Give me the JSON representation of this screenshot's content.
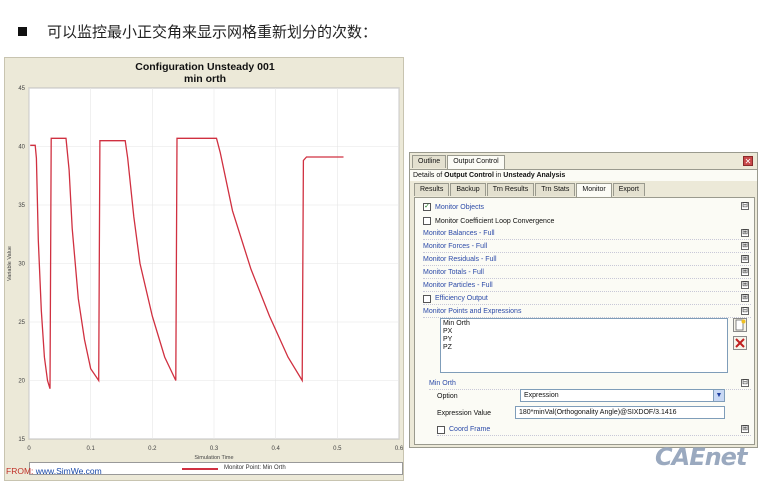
{
  "heading": "可以监控最小正交角来显示网格重新划分的次数：",
  "chart": {
    "title_line1": "Configuration Unsteady 001",
    "title_line2": "min orth",
    "legend_label": "Monitor Point: Min Orth",
    "line_color": "#d03040"
  },
  "chart_data": {
    "type": "line",
    "title": "Configuration Unsteady 001\nmin orth",
    "xlabel": "Simulation Time",
    "ylabel": "Variable Value",
    "xlim": [
      0,
      0.6
    ],
    "ylim": [
      15,
      45
    ],
    "x_ticks": [
      "0",
      "0.1",
      "0.2",
      "0.3",
      "0.4",
      "0.5",
      "0.6"
    ],
    "y_ticks": [
      "15",
      "20",
      "25",
      "30",
      "35",
      "40",
      "45"
    ],
    "grid": true,
    "legend": "bottom",
    "series": [
      {
        "name": "Monitor Point: Min Orth",
        "x": [
          0.002,
          0.01,
          0.012,
          0.015,
          0.02,
          0.025,
          0.03,
          0.034,
          0.036,
          0.04,
          0.06,
          0.065,
          0.07,
          0.08,
          0.09,
          0.1,
          0.113,
          0.115,
          0.12,
          0.156,
          0.16,
          0.17,
          0.18,
          0.2,
          0.22,
          0.238,
          0.24,
          0.245,
          0.304,
          0.31,
          0.33,
          0.36,
          0.39,
          0.42,
          0.443,
          0.445,
          0.45,
          0.51
        ],
        "y": [
          40.1,
          40.1,
          39.0,
          32.0,
          26.0,
          22.0,
          20.0,
          19.3,
          40.7,
          40.7,
          40.7,
          38.0,
          33.0,
          27.0,
          23.5,
          21.0,
          20.0,
          40.5,
          40.5,
          40.5,
          39.0,
          34.0,
          30.0,
          25.5,
          22.0,
          20.0,
          40.7,
          40.7,
          40.7,
          39.5,
          34.5,
          29.5,
          25.5,
          22.0,
          20.0,
          38.8,
          39.1,
          39.1
        ]
      }
    ]
  },
  "from_label": "FROM:",
  "from_site": "www.SimWe.com",
  "panel": {
    "tabs_top": [
      "Outline",
      "Output Control"
    ],
    "close_label": "✕",
    "details_prefix": "Details of",
    "details_object": "Output Control",
    "details_in": "in",
    "details_analysis": "Unsteady Analysis",
    "tabs_sub": [
      "Results",
      "Backup",
      "Trn Results",
      "Trn Stats",
      "Monitor",
      "Export"
    ],
    "monitor_objects": "Monitor Objects",
    "coef_loop": "Monitor Coefficient Loop Convergence",
    "sections": [
      "Monitor Balances - Full",
      "Monitor Forces - Full",
      "Monitor Residuals - Full",
      "Monitor Totals - Full",
      "Monitor Particles - Full"
    ],
    "efficiency": "Efficiency Output",
    "points_header": "Monitor Points and Expressions",
    "list_items": [
      "Min Orth",
      "PX",
      "PY",
      "PZ"
    ],
    "sub_header": "Min Orth",
    "option_label": "Option",
    "option_value": "Expression",
    "expr_label": "Expression Value",
    "expr_value": "180*minVal(Orthogonality Angle)@SIXDOF/3.1416",
    "coord_frame": "Coord Frame",
    "expand_plus": "⊞",
    "collapse_minus": "⊟",
    "check_mark": "✓"
  },
  "logo": "CAEnet"
}
